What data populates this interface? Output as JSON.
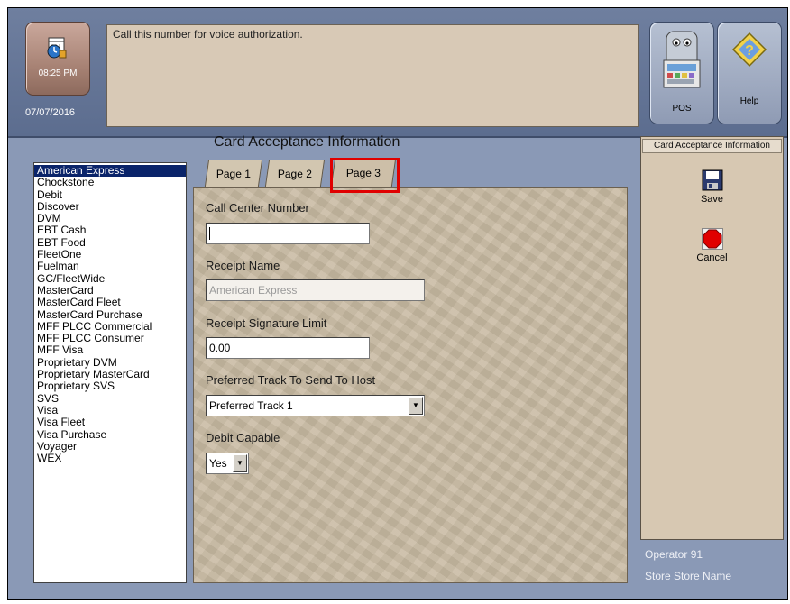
{
  "header": {
    "time": "08:25 PM",
    "date": "07/07/2016",
    "message": "Call this number for voice authorization.",
    "pos_label": "POS",
    "help_label": "Help"
  },
  "page": {
    "title": "Card Acceptance Information",
    "tabs": [
      {
        "label": "Page 1",
        "active": false
      },
      {
        "label": "Page 2",
        "active": false
      },
      {
        "label": "Page 3",
        "active": true
      }
    ]
  },
  "card_list": {
    "selected": "American Express",
    "items": [
      "American Express",
      "Chockstone",
      "Debit",
      "Discover",
      "DVM",
      "EBT Cash",
      "EBT Food",
      "FleetOne",
      "Fuelman",
      "GC/FleetWide",
      "MasterCard",
      "MasterCard Fleet",
      "MasterCard Purchase",
      "MFF PLCC Commercial",
      "MFF PLCC Consumer",
      "MFF Visa",
      "Proprietary DVM",
      "Proprietary MasterCard",
      "Proprietary SVS",
      "SVS",
      "Visa",
      "Visa Fleet",
      "Visa Purchase",
      "Voyager",
      "WEX"
    ]
  },
  "form": {
    "call_center_label": "Call Center Number",
    "call_center_value": "",
    "receipt_name_label": "Receipt Name",
    "receipt_name_value": "American Express",
    "signature_limit_label": "Receipt Signature Limit",
    "signature_limit_value": "0.00",
    "preferred_track_label": "Preferred Track To Send To Host",
    "preferred_track_value": "Preferred Track 1",
    "debit_capable_label": "Debit Capable",
    "debit_capable_value": "Yes"
  },
  "side_panel": {
    "title": "Card Acceptance Information",
    "save_label": "Save",
    "cancel_label": "Cancel"
  },
  "footer": {
    "operator": "Operator 91",
    "store": "Store Store Name"
  },
  "colors": {
    "selection": "#0a246a",
    "tab_highlight": "#e00000",
    "cancel_red": "#e00000"
  }
}
